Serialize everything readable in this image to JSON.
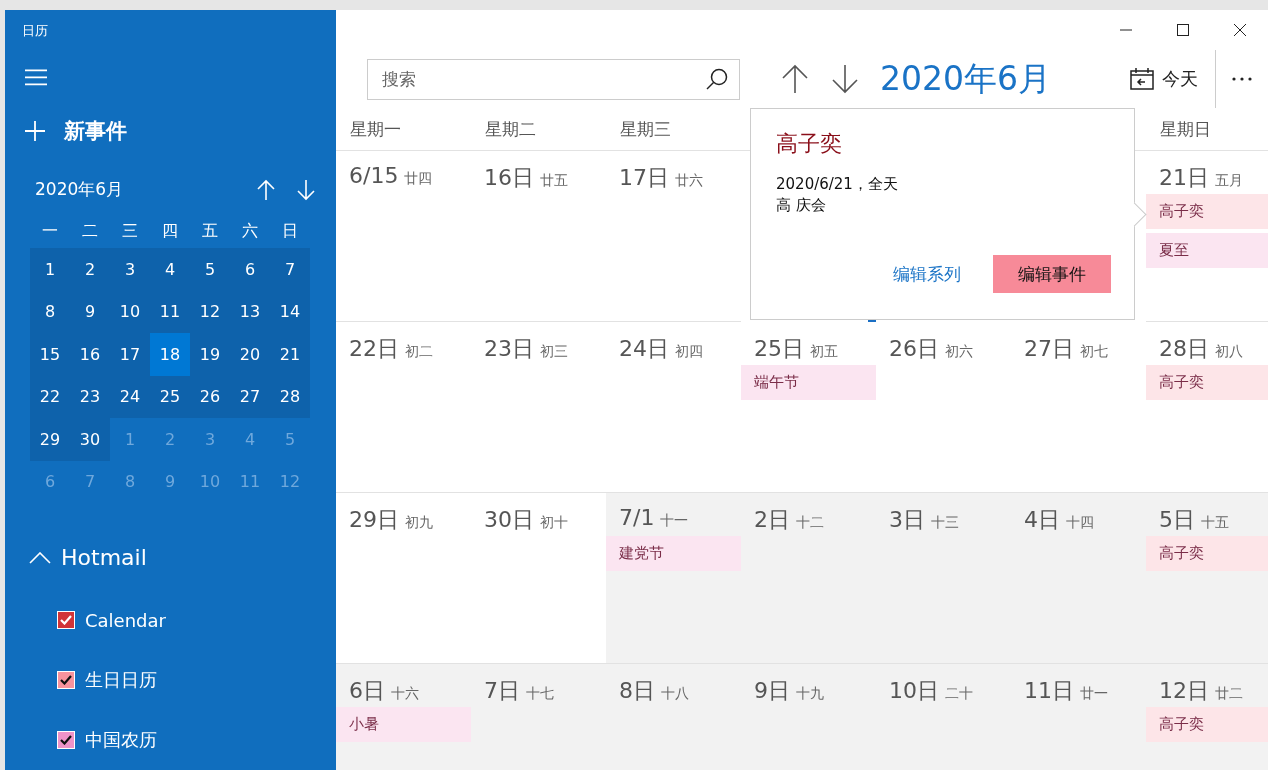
{
  "window": {
    "title": "日历"
  },
  "sidebar": {
    "new_event": "新事件",
    "mini_calendar": {
      "title": "2020年6月",
      "weekdays": [
        "一",
        "二",
        "三",
        "四",
        "五",
        "六",
        "日"
      ],
      "weeks": [
        [
          {
            "label": "1",
            "in_month": true,
            "selected": false
          },
          {
            "label": "2",
            "in_month": true,
            "selected": false
          },
          {
            "label": "3",
            "in_month": true,
            "selected": false
          },
          {
            "label": "4",
            "in_month": true,
            "selected": false
          },
          {
            "label": "5",
            "in_month": true,
            "selected": false
          },
          {
            "label": "6",
            "in_month": true,
            "selected": false
          },
          {
            "label": "7",
            "in_month": true,
            "selected": false
          }
        ],
        [
          {
            "label": "8",
            "in_month": true,
            "selected": false
          },
          {
            "label": "9",
            "in_month": true,
            "selected": false
          },
          {
            "label": "10",
            "in_month": true,
            "selected": false
          },
          {
            "label": "11",
            "in_month": true,
            "selected": false
          },
          {
            "label": "12",
            "in_month": true,
            "selected": false
          },
          {
            "label": "13",
            "in_month": true,
            "selected": false
          },
          {
            "label": "14",
            "in_month": true,
            "selected": false
          }
        ],
        [
          {
            "label": "15",
            "in_month": true,
            "selected": false
          },
          {
            "label": "16",
            "in_month": true,
            "selected": false
          },
          {
            "label": "17",
            "in_month": true,
            "selected": false
          },
          {
            "label": "18",
            "in_month": true,
            "selected": true
          },
          {
            "label": "19",
            "in_month": true,
            "selected": false
          },
          {
            "label": "20",
            "in_month": true,
            "selected": false
          },
          {
            "label": "21",
            "in_month": true,
            "selected": false
          }
        ],
        [
          {
            "label": "22",
            "in_month": true,
            "selected": false
          },
          {
            "label": "23",
            "in_month": true,
            "selected": false
          },
          {
            "label": "24",
            "in_month": true,
            "selected": false
          },
          {
            "label": "25",
            "in_month": true,
            "selected": false
          },
          {
            "label": "26",
            "in_month": true,
            "selected": false
          },
          {
            "label": "27",
            "in_month": true,
            "selected": false
          },
          {
            "label": "28",
            "in_month": true,
            "selected": false
          }
        ],
        [
          {
            "label": "29",
            "in_month": true,
            "selected": false
          },
          {
            "label": "30",
            "in_month": true,
            "selected": false
          },
          {
            "label": "1",
            "in_month": false,
            "selected": false
          },
          {
            "label": "2",
            "in_month": false,
            "selected": false
          },
          {
            "label": "3",
            "in_month": false,
            "selected": false
          },
          {
            "label": "4",
            "in_month": false,
            "selected": false
          },
          {
            "label": "5",
            "in_month": false,
            "selected": false
          }
        ],
        [
          {
            "label": "6",
            "in_month": false,
            "selected": false
          },
          {
            "label": "7",
            "in_month": false,
            "selected": false
          },
          {
            "label": "8",
            "in_month": false,
            "selected": false
          },
          {
            "label": "9",
            "in_month": false,
            "selected": false
          },
          {
            "label": "10",
            "in_month": false,
            "selected": false
          },
          {
            "label": "11",
            "in_month": false,
            "selected": false
          },
          {
            "label": "12",
            "in_month": false,
            "selected": false
          }
        ]
      ]
    },
    "account": {
      "name": "Hotmail",
      "expanded": true,
      "calendars": [
        {
          "label": "Calendar",
          "checked": true,
          "color": "#d13438"
        },
        {
          "label": "生日日历",
          "checked": true,
          "color": "#f7939d"
        },
        {
          "label": "中国农历",
          "checked": true,
          "color": "#ee93c8"
        }
      ]
    }
  },
  "toolbar": {
    "search": {
      "placeholder": "搜索"
    },
    "month_title": "2020年6月",
    "today_button": "今天"
  },
  "month": {
    "weekdays": [
      {
        "label": "星期一"
      },
      {
        "label": "星期二"
      },
      {
        "label": "星期三"
      },
      {
        "label": "星期日"
      }
    ],
    "weeks": [
      [
        {
          "date": "6/15",
          "lunar": "廿四",
          "in_month": true
        },
        {
          "date": "16日",
          "lunar": "廿五",
          "in_month": true
        },
        {
          "date": "17日",
          "lunar": "廿六",
          "in_month": true
        },
        {
          "today": true
        },
        {
          "date": "21日",
          "lunar": "五月",
          "in_month": true,
          "events": [
            {
              "title": "高子奕",
              "color": "#fde5e8"
            },
            {
              "title": "夏至",
              "color": "#fbe5f1"
            }
          ]
        }
      ],
      [
        {
          "date": "22日",
          "lunar": "初二",
          "in_month": true
        },
        {
          "date": "23日",
          "lunar": "初三",
          "in_month": true
        },
        {
          "date": "24日",
          "lunar": "初四",
          "in_month": true
        },
        {
          "date": "25日",
          "lunar": "初五",
          "in_month": true,
          "events": [
            {
              "title": "端午节",
              "color": "#fbe5f1"
            }
          ]
        },
        {
          "date": "26日",
          "lunar": "初六",
          "in_month": true
        },
        {
          "date": "27日",
          "lunar": "初七",
          "in_month": true
        },
        {
          "date": "28日",
          "lunar": "初八",
          "in_month": true,
          "events": [
            {
              "title": "高子奕",
              "color": "#fde5e8"
            }
          ]
        }
      ],
      [
        {
          "date": "29日",
          "lunar": "初九",
          "in_month": true
        },
        {
          "date": "30日",
          "lunar": "初十",
          "in_month": true
        },
        {
          "date": "7/1",
          "lunar": "十一",
          "in_month": false,
          "events": [
            {
              "title": "建党节",
              "color": "#fbe5f1"
            }
          ]
        },
        {
          "date": "2日",
          "lunar": "十二",
          "in_month": false
        },
        {
          "date": "3日",
          "lunar": "十三",
          "in_month": false
        },
        {
          "date": "4日",
          "lunar": "十四",
          "in_month": false
        },
        {
          "date": "5日",
          "lunar": "十五",
          "in_month": false,
          "events": [
            {
              "title": "高子奕",
              "color": "#fde5e8"
            }
          ]
        }
      ],
      [
        {
          "date": "6日",
          "lunar": "十六",
          "in_month": false,
          "events": [
            {
              "title": "小暑",
              "color": "#fbe5f1"
            }
          ]
        },
        {
          "date": "7日",
          "lunar": "十七",
          "in_month": false
        },
        {
          "date": "8日",
          "lunar": "十八",
          "in_month": false
        },
        {
          "date": "9日",
          "lunar": "十九",
          "in_month": false
        },
        {
          "date": "10日",
          "lunar": "二十",
          "in_month": false
        },
        {
          "date": "11日",
          "lunar": "廿一",
          "in_month": false
        },
        {
          "date": "12日",
          "lunar": "廿二",
          "in_month": false,
          "events": [
            {
              "title": "高子奕",
              "color": "#fde5e8"
            }
          ]
        }
      ]
    ]
  },
  "popup": {
    "title": "高子奕",
    "when": "2020/6/21，全天",
    "organizer": "高 庆会",
    "actions": [
      {
        "label": "编辑系列",
        "kind": "link"
      },
      {
        "label": "编辑事件",
        "kind": "primary"
      }
    ]
  }
}
